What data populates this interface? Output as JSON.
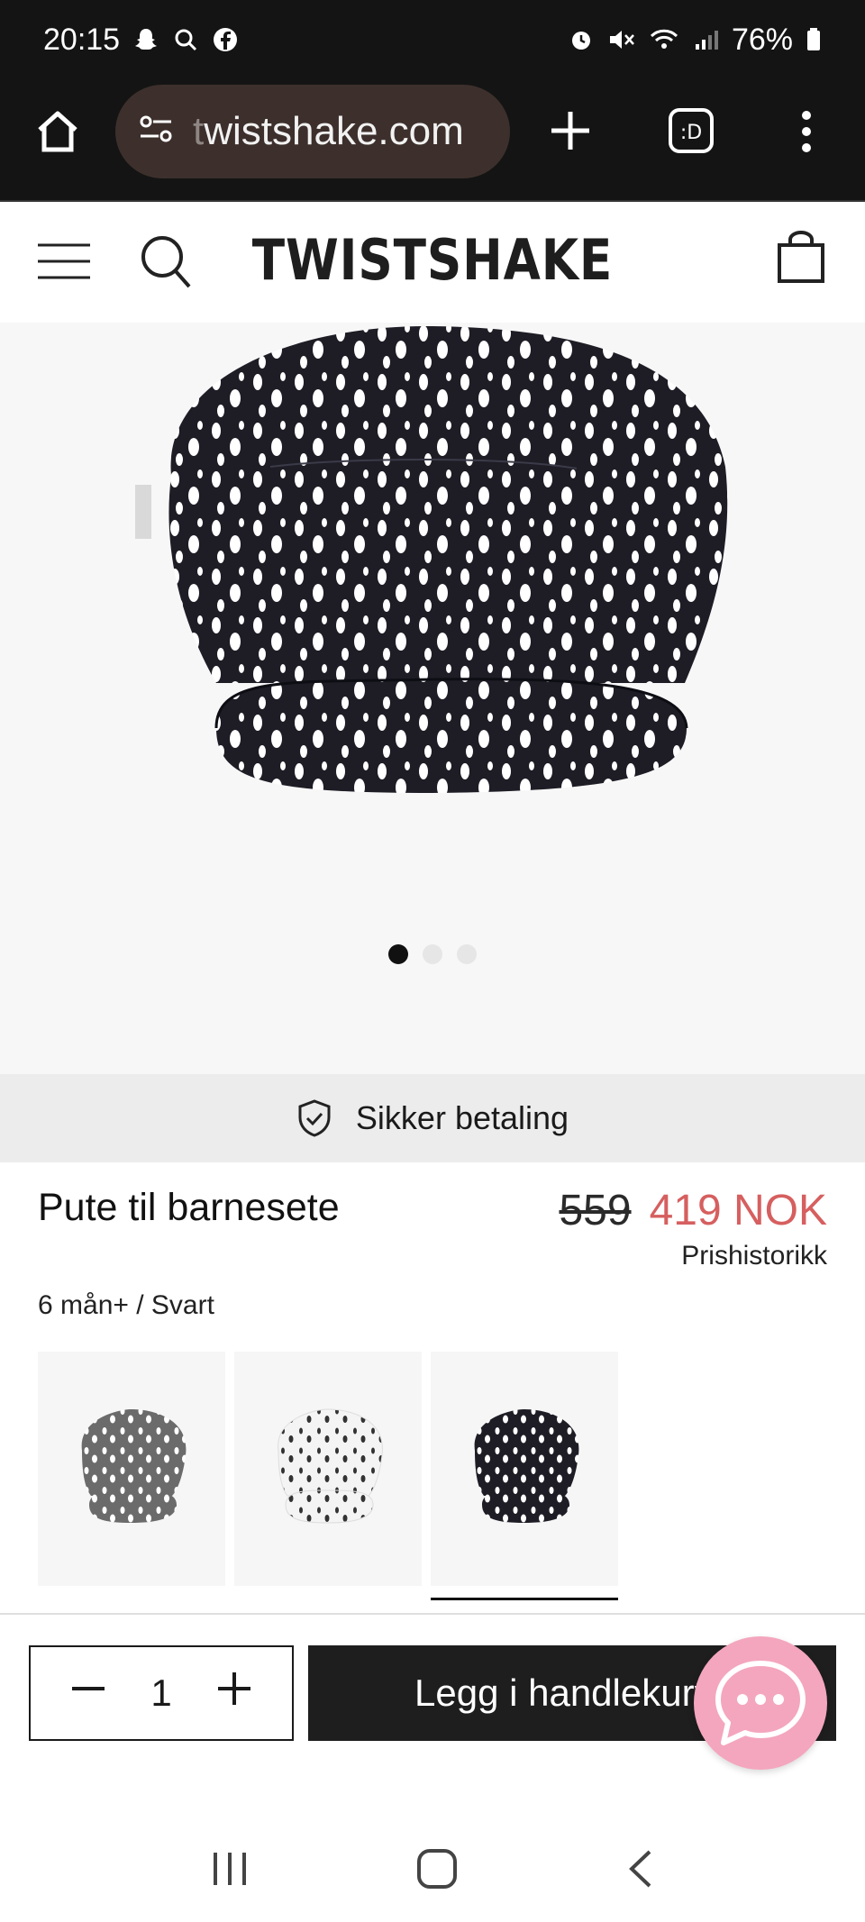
{
  "status_bar": {
    "time": "20:15",
    "battery": "76%"
  },
  "browser": {
    "url_prefix": "t",
    "url_rest": "wistshake.com"
  },
  "site": {
    "logo": "TWISTSHAKE"
  },
  "gallery": {
    "image_count": 3,
    "active_index": 0
  },
  "secure_payment": {
    "label": "Sikker betaling"
  },
  "product": {
    "title": "Pute til barnesete",
    "old_price": "559",
    "price": "419 NOK",
    "price_history": "Prishistorikk",
    "variant": "6 mån+ / Svart",
    "swatches": [
      {
        "color": "grey",
        "fill": "#6b6b6b"
      },
      {
        "color": "white",
        "fill": "#f4f4f4"
      },
      {
        "color": "black",
        "fill": "#1e1d26"
      }
    ],
    "selected_swatch": 2
  },
  "cart": {
    "quantity": "1",
    "add_label": "Legg i handlekurv"
  },
  "colors": {
    "accent_price": "#d65f5f",
    "chat_button": "#f4a6be",
    "dark_button": "#1e1e1e"
  }
}
